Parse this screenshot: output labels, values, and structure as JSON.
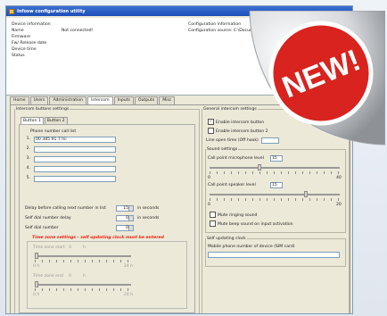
{
  "window": {
    "title": "Infosw configuration utility"
  },
  "device_info": {
    "header": "Device information",
    "rows": [
      {
        "label": "Name",
        "value": "Not connected!"
      },
      {
        "label": "Firmware",
        "value": ""
      },
      {
        "label": "Fw/ Release date",
        "value": ""
      },
      {
        "label": "Device time",
        "value": ""
      },
      {
        "label": "Status",
        "value": ""
      }
    ]
  },
  "config_info": {
    "header": "Configuration information",
    "source_label": "Configuration source:",
    "source_value": "C:\\Docum"
  },
  "tabs": [
    "Home",
    "Users",
    "Administration",
    "Intercom",
    "Inputs",
    "Outputs",
    "Misc"
  ],
  "intercom_settings": {
    "legend": "Intercom buttons settings",
    "subtabs": [
      "Button 1",
      "Button 2"
    ],
    "phone_list_label": "Phone number call list",
    "phone_numbers": [
      "00 385 91 7 hii",
      "",
      "",
      "",
      ""
    ],
    "phone_indices": [
      "1.",
      "2.",
      "3.",
      "4.",
      "5."
    ],
    "delay_label": "Delay before calling next number in list",
    "delay_value": "15",
    "delay_unit": "in seconds",
    "self_dial_delay_label": "Self dial number delay",
    "self_dial_delay_value": "0",
    "self_dial_delay_unit": "in seconds",
    "self_dial_number_label": "Self dial number",
    "self_dial_number_value": "0",
    "time_zone_title": "Time zone settings - self updating clock must be entered",
    "tz_start_label": "Time zone start",
    "tz_start_value": "0",
    "tz_start_unit": "h",
    "tz_end_label": "Time zone end",
    "tz_end_value": "0",
    "tz_end_unit": "h",
    "scale_min": "0 h",
    "scale_max": "24 h"
  },
  "general_settings": {
    "legend": "General intercom settings",
    "enable_btn1": "Enable intercom button",
    "enable_btn1_checked": true,
    "enable_btn2": "Enable intercom button 2",
    "enable_btn2_checked": false,
    "line_open_label": "Line open time (Off hook)",
    "sound_legend": "Sound settings",
    "mic_level_label": "Call point microphone level",
    "mic_level_value": "15",
    "mic_scale_min": "0",
    "mic_scale_max": "40",
    "speaker_level_label": "Call point speaker level",
    "speaker_level_value": "15",
    "speaker_scale_min": "0",
    "speaker_scale_max": "20",
    "mute_ringing": "Mute ringing sound",
    "mute_beep": "Mute beep sound on input activation",
    "clock_legend": "Self updating clock",
    "clock_label": "Mobile phone number of device (SIM card)"
  },
  "badge": {
    "text": "NEW!",
    "color": "#d8231e"
  }
}
